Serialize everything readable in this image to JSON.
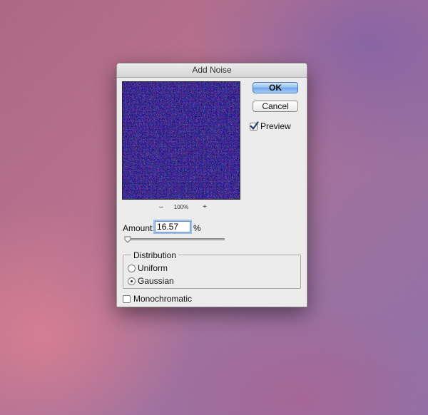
{
  "dialog": {
    "title": "Add Noise",
    "ok_label": "OK",
    "cancel_label": "Cancel",
    "preview_label": "Preview",
    "preview_checked": true,
    "zoom_minus": "–",
    "zoom_level": "100%",
    "zoom_plus": "+",
    "amount_label": "Amount:",
    "amount_value": "16.57",
    "amount_unit": "%",
    "amount_slider_fraction": 0.0,
    "distribution": {
      "label": "Distribution",
      "options": [
        "Uniform",
        "Gaussian"
      ],
      "selected": "Gaussian"
    },
    "monochromatic_label": "Monochromatic",
    "monochromatic_checked": false
  },
  "colors": {
    "ok_button": "#6aa3ea",
    "preview_base": "#6b5c9a",
    "input_focus_ring": "#9ec0ee"
  },
  "icons": {
    "check": "check-icon",
    "slider": "slider-thumb-icon"
  }
}
